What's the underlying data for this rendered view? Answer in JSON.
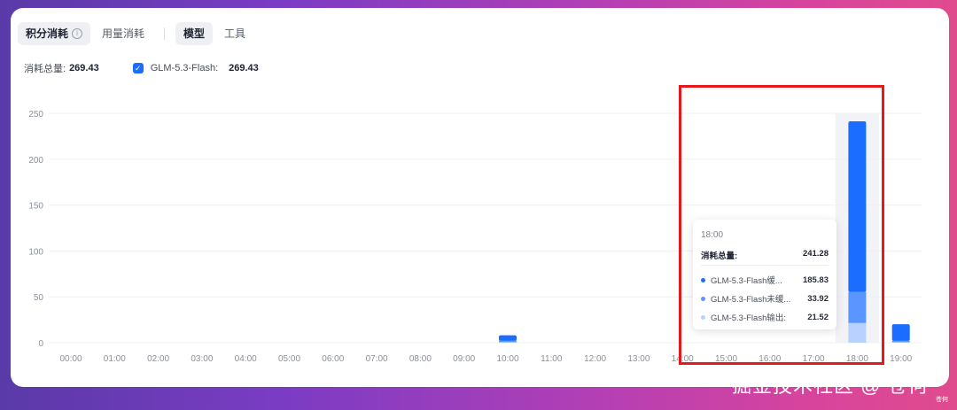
{
  "tabs": [
    {
      "label": "积分消耗",
      "active": true,
      "info_icon": "info-icon"
    },
    {
      "label": "用量消耗",
      "active": false
    },
    {
      "label": "模型",
      "active": true
    },
    {
      "label": "工具",
      "active": false
    }
  ],
  "summary": {
    "total_label": "消耗总量:",
    "total_value": "269.43",
    "model_label": "GLM-5.3-Flash:",
    "model_value": "269.43",
    "checked": true
  },
  "tooltip": {
    "time": "18:00",
    "total_label": "消耗总量:",
    "total_value": "241.28",
    "rows": [
      {
        "name": "GLM-5.3-Flash缓...",
        "value": "185.83",
        "color": "#1a6dff"
      },
      {
        "name": "GLM-5.3-Flash未缓...",
        "value": "33.92",
        "color": "#5b95ff"
      },
      {
        "name": "GLM-5.3-Flash输出:",
        "value": "21.52",
        "color": "#b8d1ff"
      }
    ]
  },
  "watermark": {
    "text": "掘金技术社区 @ 苍何",
    "small": "苍何"
  },
  "chart_data": {
    "type": "bar",
    "stacked": true,
    "categories": [
      "00:00",
      "01:00",
      "02:00",
      "03:00",
      "04:00",
      "05:00",
      "06:00",
      "07:00",
      "08:00",
      "09:00",
      "10:00",
      "11:00",
      "12:00",
      "13:00",
      "14:00",
      "15:00",
      "16:00",
      "17:00",
      "18:00",
      "19:00"
    ],
    "series": [
      {
        "name": "GLM-5.3-Flash缓...",
        "color": "#1a6dff",
        "values": [
          0,
          0,
          0,
          0,
          0,
          0,
          0,
          0,
          0,
          0,
          6,
          0,
          0,
          0,
          0,
          0,
          0,
          0,
          185.83,
          18
        ]
      },
      {
        "name": "GLM-5.3-Flash未缓...",
        "color": "#5b95ff",
        "values": [
          0,
          0,
          0,
          0,
          0,
          0,
          0,
          0,
          0,
          0,
          1.5,
          0,
          0,
          0,
          0,
          0,
          0,
          0,
          33.92,
          1.5
        ]
      },
      {
        "name": "GLM-5.3-Flash输出:",
        "color": "#b8d1ff",
        "values": [
          0,
          0,
          0,
          0,
          0,
          0,
          0,
          0,
          0,
          0,
          0.6,
          0,
          0,
          0,
          0,
          0,
          0,
          0,
          21.52,
          0.6
        ]
      }
    ],
    "yticks": [
      0,
      50,
      100,
      150,
      200,
      250
    ],
    "ylim": [
      0,
      250
    ],
    "highlight_category": "18:00",
    "grid": true,
    "colors": {
      "grid": "#eef0f3",
      "axis_text": "#8a909b",
      "highlight_bg": "#f2f3f6"
    }
  }
}
